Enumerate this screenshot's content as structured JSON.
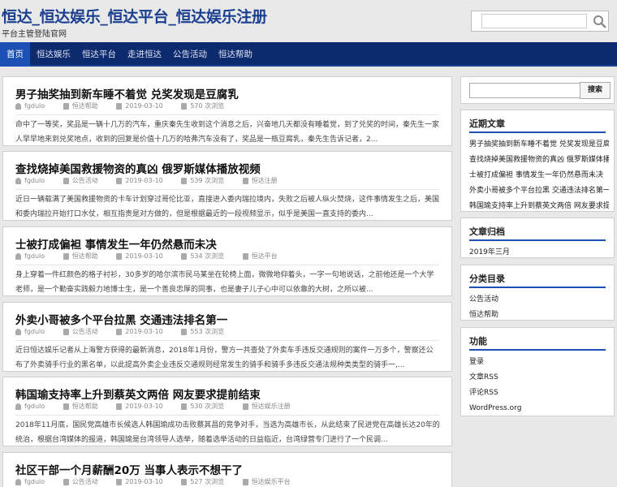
{
  "header": {
    "title": "恒达_恒达娱乐_恒达平台_恒达娱乐注册",
    "description": "平台主管登陆官网",
    "search_placeholder": ""
  },
  "nav": {
    "items": [
      {
        "label": "首页",
        "active": true
      },
      {
        "label": "恒达娱乐",
        "active": false
      },
      {
        "label": "恒达平台",
        "active": false
      },
      {
        "label": "走进恒达",
        "active": false
      },
      {
        "label": "公告活动",
        "active": false
      },
      {
        "label": "恒达帮助",
        "active": false
      }
    ]
  },
  "posts": [
    {
      "title": "男子抽奖抽到新车睡不着觉 兑奖发现是豆腐乳",
      "author": "fgdulo",
      "category": "恒达帮助",
      "date": "2019-03-10",
      "views": "570 次浏览",
      "tag": "",
      "excerpt": "命中了一等奖，奖品是一辆十几万的汽车，重庆秦先生收到这个消息之后，兴奋地几天都没有睡着觉，到了兑奖的时间，秦先生一家人早早地来到兑奖地点，收到的回复是价值十几万的哈弗汽车没有了，奖品是一瓶豆腐乳，秦先生告诉记者，2..."
    },
    {
      "title": "查找烧掉美国救援物资的真凶 俄罗斯媒体播放视频",
      "author": "fgdulo",
      "category": "公告活动",
      "date": "2019-03-10",
      "views": "539 次浏览",
      "tag": "恒达注册",
      "excerpt": "近日一辆载满了美国救援物资的卡车计划穿过哥伦比亚，直接进入委内瑞拉境内，失败之后被人纵火焚烧，这件事情发生之后，美国和委内瑞拉开始打口水仗，相互指责是对方做的，但是根据最近的一段视频显示，似乎是美国一直支持的委内..."
    },
    {
      "title": "士被打成偏袒 事情发生一年仍然悬而未决",
      "author": "fgdulo",
      "category": "恒达帮助",
      "date": "2019-03-10",
      "views": "534 次浏览",
      "tag": "恒达平台",
      "excerpt": "身上穿着一件红颜色的格子衬衫，30多岁的哈尔滨市民马某坐在轮椅上面，微微地仰着头，一字一句地说话，之前他还是一个大学老师，是一个勤奋实践毅力地博士生，是一个善良忠厚的同事，也是妻子儿子心中可以依靠的大树，之所以被..."
    },
    {
      "title": "外卖小哥被多个平台拉黑 交通违法排名第一",
      "author": "fgdulo",
      "category": "公告活动",
      "date": "2019-03-10",
      "views": "553 次浏览",
      "tag": "",
      "excerpt": "近日恒达娱乐记者从上海警方获得的最新消息，2018年1月份，警方一共查处了外卖车手违反交通规则的案件一万多个，警察还公布了外卖骑手行业的黑名单，以此提高外卖企业违反交通规则经常发生的骑手和骑手多违反交通法规种类类型的骑手一,..."
    },
    {
      "title": "韩国瑜支持率上升到蔡英文两倍 网友要求提前结束",
      "author": "fgdulo",
      "category": "恒达帮助",
      "date": "2019-03-10",
      "views": "530 次浏览",
      "tag": "恒达娱乐注册",
      "excerpt": "2018年11月底，国民党高雄市长候选人韩国瑜成功击败蔡其昌的竞争对手，当选为高雄市长，从此结束了民进党在高雄长达20年的统治，根据台湾媒体的报道，韩国瑜是台湾领导人选举，随着选举活动的日益临近，台湾绿营专门进行了一个民调..."
    },
    {
      "title": "社区干部一个月薪酬20万 当事人表示不想干了",
      "author": "fgdulo",
      "category": "公告活动",
      "date": "2019-03-10",
      "views": "527 次浏览",
      "tag": "恒达娱乐平台",
      "excerpt": ""
    }
  ],
  "sidebar": {
    "search_button": "搜索",
    "recent": {
      "title": "近期文章",
      "items": [
        "男子抽奖抽到新车睡不着觉 兑奖发现是豆腐乳",
        "查找烧掉美国救援物资的真凶 俄罗斯媒体播放视频",
        "士被打成偏袒 事情发生一年仍然悬而未决",
        "外卖小哥被多个平台拉黑 交通违法排名第一",
        "韩国瑜支持率上升到蔡英文两倍 网友要求提前结束"
      ]
    },
    "archives": {
      "title": "文章归档",
      "items": [
        "2019年三月"
      ]
    },
    "categories": {
      "title": "分类目录",
      "items": [
        "公告活动",
        "恒达帮助"
      ]
    },
    "meta": {
      "title": "功能",
      "items": [
        "登录",
        "文章RSS",
        "评论RSS",
        "WordPress.org"
      ]
    }
  },
  "colors": {
    "nav_bg": "#0c2a6d",
    "nav_active": "#1d50b4",
    "title": "#1b3f8f"
  }
}
